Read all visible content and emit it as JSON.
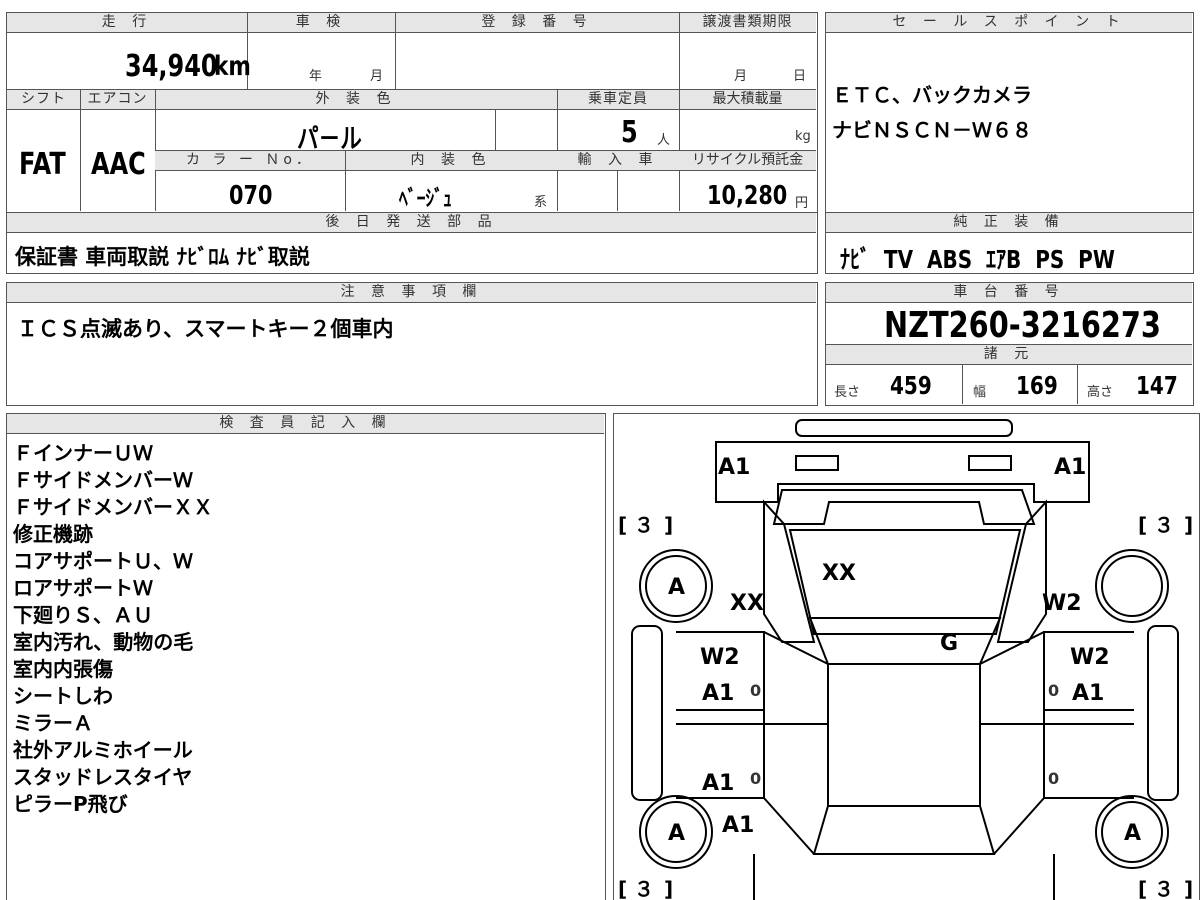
{
  "header": {
    "mileage_label": "走 行",
    "mileage_value": "34,940",
    "mileage_unit": "km",
    "shaken_label": "車 検",
    "shaken_year": "年",
    "shaken_month": "月",
    "registration_label": "登 録 番 号",
    "transfer_label": "譲渡書類期限",
    "transfer_month": "月",
    "transfer_day": "日"
  },
  "specs": {
    "shift_label": "シフト",
    "shift_value": "FAT",
    "ac_label": "エアコン",
    "ac_value": "AAC",
    "exterior_label": "外 装 色",
    "exterior_value": "パ－ル",
    "capacity_label": "乗車定員",
    "capacity_value": "5",
    "capacity_unit": "人",
    "maxload_label": "最大積載量",
    "maxload_unit": "kg",
    "color_no_label": "カ ラ ー Ｎo．",
    "color_no_value": "070",
    "interior_label": "内 装 色",
    "interior_value": "ﾍﾞｰｼﾞｭ",
    "interior_suffix": "系",
    "import_label": "輸 入 車",
    "recycle_label": "リサイクル預託金",
    "recycle_value": "10,280",
    "recycle_unit": "円"
  },
  "later_parts": {
    "label": "後 日 発 送 部 品",
    "value": "保証書 車両取説 ﾅﾋﾞﾛﾑ ﾅﾋﾞ取説"
  },
  "sales_point": {
    "label": "セ ー ル ス ポ イ ン ト",
    "lines": [
      "ＥＴＣ、バックカメラ",
      "ナビＮＳＣＮ－Ｗ６８"
    ]
  },
  "equipment": {
    "label": "純 正 装 備",
    "value": "ﾅﾋﾞ  TV  ABS  ｴｱB  PS  PW"
  },
  "notes": {
    "label": "注 意 事 項 欄",
    "value": "ＩＣＳ点滅あり、スマートキー２個車内"
  },
  "chassis": {
    "label": "車 台 番 号",
    "value": "NZT260-3216273"
  },
  "dimensions": {
    "label": "諸 元",
    "length_label": "長さ",
    "length_value": "459",
    "width_label": "幅",
    "width_value": "169",
    "height_label": "高さ",
    "height_value": "147"
  },
  "inspector": {
    "label": "検 査 員 記 入 欄",
    "lines": [
      "ＦインナーＵＷ",
      "ＦサイドメンバーＷ",
      "ＦサイドメンバーＸＸ",
      "修正機跡",
      "コアサポートＵ、Ｗ",
      "ロアサポートＷ",
      "下廻りＳ、ＡＵ",
      "室内汚れ、動物の毛",
      "室内内張傷",
      "シートしわ",
      "ミラーＡ",
      "社外アルミホイール",
      "スタッドレスタイヤ",
      "ピラーP飛び"
    ]
  },
  "diagram": {
    "marks": {
      "front_left": "A1",
      "front_right": "A1",
      "hood": "XX",
      "front_fender_left": "XX",
      "front_fender_right": "W2",
      "windshield": "G",
      "front_door_left_1": "W2",
      "front_door_left_2": "A1",
      "front_door_right_1": "W2",
      "front_door_right_2": "A1",
      "rear_door_left": "A1",
      "rear_left": "A1",
      "wheel_fl": "A",
      "wheel_fr": "",
      "wheel_rl": "A",
      "wheel_rr": "A",
      "tire_fl": "３",
      "tire_fr": "３",
      "tire_rl": "３",
      "tire_rr": "３",
      "zero": "0"
    }
  }
}
